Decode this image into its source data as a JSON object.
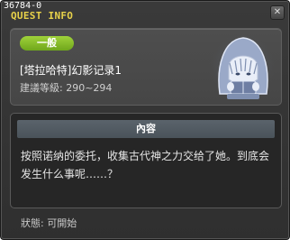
{
  "window": {
    "id_label": "36784-0",
    "title": "QUEST INFO",
    "close_icon": "close-icon"
  },
  "quest": {
    "category": "一般",
    "name": "[塔拉哈特]幻影记录1",
    "level_range": "建議等級: 290~294",
    "portrait_icon": "hooded-npc-portrait"
  },
  "content": {
    "header": "內容",
    "body": "按照诺纳的委托，收集古代神之力交给了她。到底会发生什么事呢……？"
  },
  "status": {
    "text": "狀態:  可開始"
  },
  "colors": {
    "title_yellow": "#e8d24a",
    "badge_green": "#8cc42c",
    "panel_bg": "#4a4a4a",
    "content_bg": "#262626"
  }
}
